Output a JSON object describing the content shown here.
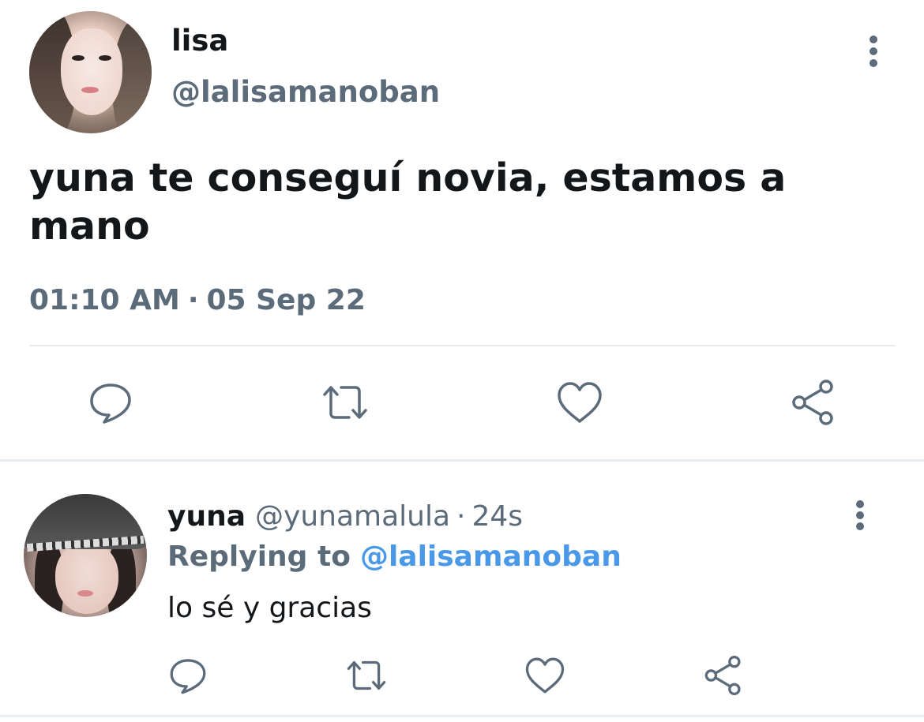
{
  "main_tweet": {
    "display_name": "lisa",
    "handle": "@lalisamanoban",
    "text": "yuna te conseguí novia, estamos a mano",
    "time": "01:10 AM",
    "separator": "·",
    "date": "05 Sep 22",
    "actions": [
      "reply-icon",
      "retweet-icon",
      "like-icon",
      "share-icon"
    ]
  },
  "reply_tweet": {
    "display_name": "yuna",
    "handle": "@yunamalula",
    "separator": "·",
    "age": "24s",
    "replying_label": "Replying to",
    "replying_target": "@lalisamanoban",
    "text": "lo sé y gracias",
    "actions": [
      "reply-icon",
      "retweet-icon",
      "like-icon",
      "share-icon"
    ]
  },
  "colors": {
    "primary_text": "#14171a",
    "secondary_text": "#5b6b7a",
    "link": "#4a99e9",
    "divider": "#e6ecf0",
    "icon": "#5b6b7a"
  }
}
